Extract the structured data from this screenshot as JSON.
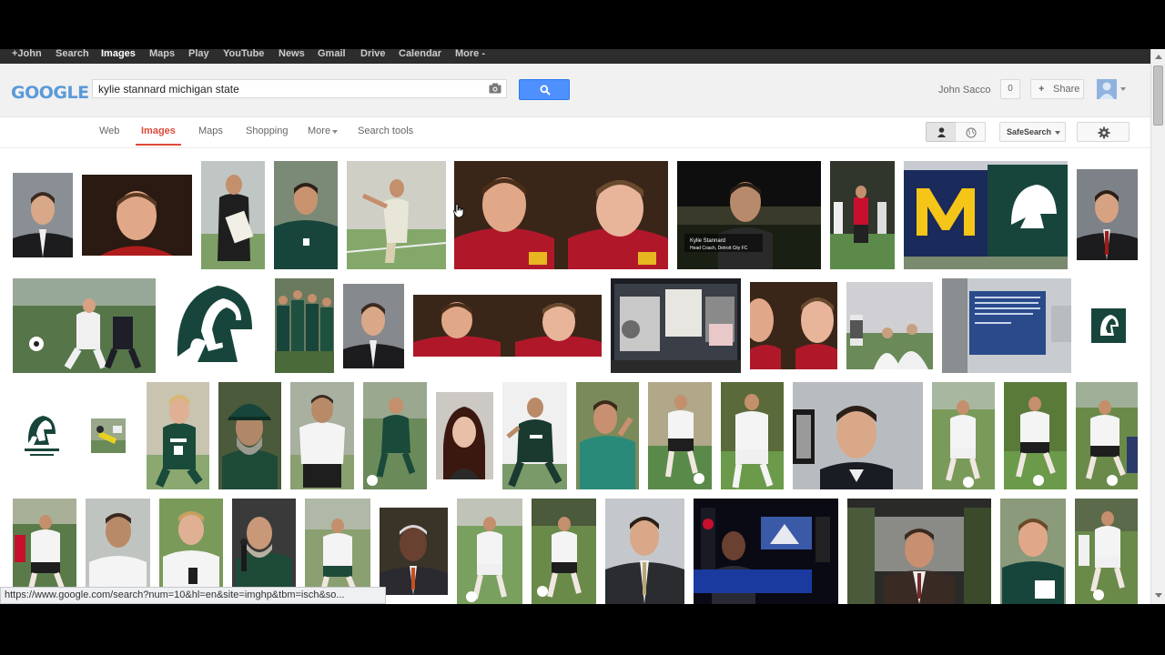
{
  "topbar": {
    "links": [
      {
        "label": "+John",
        "active": false
      },
      {
        "label": "Search",
        "active": false
      },
      {
        "label": "Images",
        "active": true
      },
      {
        "label": "Maps",
        "active": false
      },
      {
        "label": "Play",
        "active": false
      },
      {
        "label": "YouTube",
        "active": false
      },
      {
        "label": "News",
        "active": false
      },
      {
        "label": "Gmail",
        "active": false
      },
      {
        "label": "Drive",
        "active": false
      },
      {
        "label": "Calendar",
        "active": false
      },
      {
        "label": "More -",
        "active": false
      }
    ]
  },
  "header": {
    "logo": "GOOGLE",
    "search": {
      "value": "kylie stannard michigan state",
      "placeholder": ""
    },
    "user_name": "John Sacco",
    "notification_count": "0",
    "share_label": "Share",
    "share_plus": "+"
  },
  "nav": {
    "tabs": [
      {
        "label": "Web",
        "active": false
      },
      {
        "label": "Images",
        "active": true
      },
      {
        "label": "Maps",
        "active": false
      },
      {
        "label": "Shopping",
        "active": false
      },
      {
        "label": "More",
        "active": false
      },
      {
        "label": "Search tools",
        "active": false
      }
    ],
    "safesearch_label": "SafeSearch"
  },
  "status_url": "https://www.google.com/search?num=10&hl=en&site=imghp&tbm=isch&so...",
  "results": {
    "caption_video_name": "Kylie Stannard",
    "caption_video_title": "Head Coach, Detroit City FC",
    "thumbnail_count": 60
  },
  "colors": {
    "accent_red": "#dd4b39",
    "search_blue": "#4d90fe",
    "msu_green": "#18453b",
    "michigan_maize": "#f5c518",
    "michigan_blue": "#1a2a5a"
  }
}
